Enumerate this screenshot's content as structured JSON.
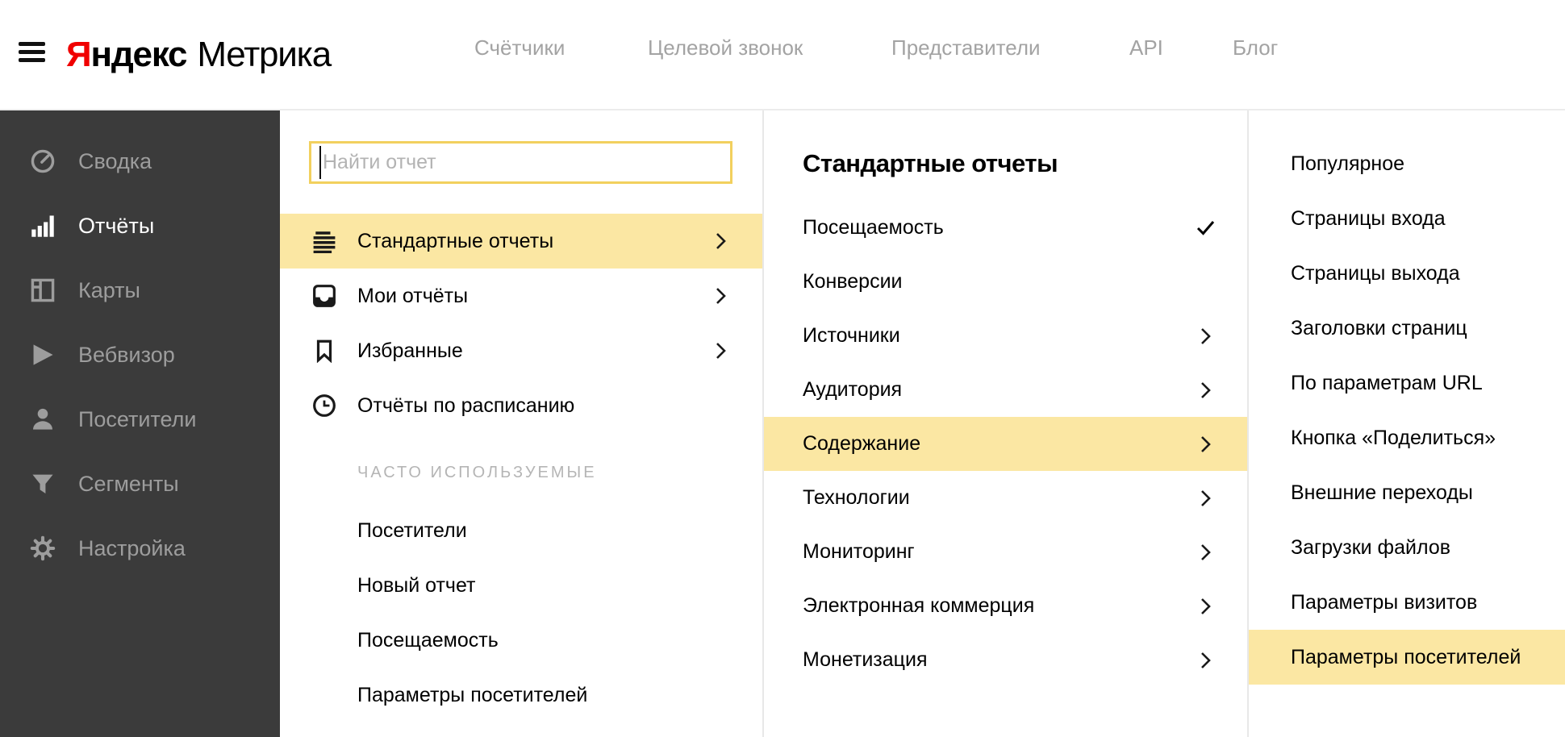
{
  "header": {
    "logo": {
      "brand_first_letter": "Я",
      "brand_rest": "ндекс",
      "product": "Метрика"
    },
    "nav": [
      {
        "label": "Счётчики"
      },
      {
        "label": "Целевой звонок"
      },
      {
        "label": "Представители"
      },
      {
        "label": "API"
      },
      {
        "label": "Блог"
      }
    ]
  },
  "sidebar": {
    "items": [
      {
        "label": "Сводка",
        "icon": "gauge-icon",
        "active": false
      },
      {
        "label": "Отчёты",
        "icon": "bar-chart-icon",
        "active": true
      },
      {
        "label": "Карты",
        "icon": "layout-icon",
        "active": false
      },
      {
        "label": "Вебвизор",
        "icon": "play-icon",
        "active": false
      },
      {
        "label": "Посетители",
        "icon": "person-icon",
        "active": false
      },
      {
        "label": "Сегменты",
        "icon": "funnel-icon",
        "active": false
      },
      {
        "label": "Настройка",
        "icon": "gear-icon",
        "active": false
      }
    ]
  },
  "reports_menu": {
    "search": {
      "placeholder": "Найти отчет"
    },
    "sections": [
      {
        "label": "Стандартные отчеты",
        "icon": "list-icon",
        "highlighted": true,
        "chevron": true
      },
      {
        "label": "Мои отчёты",
        "icon": "inbox-icon",
        "highlighted": false,
        "chevron": true
      },
      {
        "label": "Избранные",
        "icon": "bookmark-icon",
        "highlighted": false,
        "chevron": true
      },
      {
        "label": "Отчёты по расписанию",
        "icon": "clock-icon",
        "highlighted": false,
        "chevron": false
      }
    ],
    "frequent": {
      "title": "ЧАСТО ИСПОЛЬЗУЕМЫЕ",
      "items": [
        {
          "label": "Посетители"
        },
        {
          "label": "Новый отчет"
        },
        {
          "label": "Посещаемость"
        },
        {
          "label": "Параметры посетителей"
        }
      ]
    }
  },
  "standard_reports": {
    "title": "Стандартные отчеты",
    "items": [
      {
        "label": "Посещаемость",
        "checked": true,
        "chevron": false,
        "highlighted": false
      },
      {
        "label": "Конверсии",
        "checked": false,
        "chevron": false,
        "highlighted": false
      },
      {
        "label": "Источники",
        "checked": false,
        "chevron": true,
        "highlighted": false
      },
      {
        "label": "Аудитория",
        "checked": false,
        "chevron": true,
        "highlighted": false
      },
      {
        "label": "Содержание",
        "checked": false,
        "chevron": true,
        "highlighted": true
      },
      {
        "label": "Технологии",
        "checked": false,
        "chevron": true,
        "highlighted": false
      },
      {
        "label": "Мониторинг",
        "checked": false,
        "chevron": true,
        "highlighted": false
      },
      {
        "label": "Электронная коммерция",
        "checked": false,
        "chevron": true,
        "highlighted": false
      },
      {
        "label": "Монетизация",
        "checked": false,
        "chevron": true,
        "highlighted": false
      }
    ]
  },
  "content_submenu": {
    "items": [
      {
        "label": "Популярное",
        "highlighted": false
      },
      {
        "label": "Страницы входа",
        "highlighted": false
      },
      {
        "label": "Страницы выхода",
        "highlighted": false
      },
      {
        "label": "Заголовки страниц",
        "highlighted": false
      },
      {
        "label": "По параметрам URL",
        "highlighted": false
      },
      {
        "label": "Кнопка «Поделиться»",
        "highlighted": false
      },
      {
        "label": "Внешние переходы",
        "highlighted": false
      },
      {
        "label": "Загрузки файлов",
        "highlighted": false
      },
      {
        "label": "Параметры визитов",
        "highlighted": false
      },
      {
        "label": "Параметры посетителей",
        "highlighted": true
      }
    ]
  },
  "colors": {
    "highlight_yellow": "#fbe7a3",
    "search_border_yellow": "#f2d05e",
    "sidebar_background": "#3b3b3b",
    "sidebar_inactive_text": "#9d9d9d",
    "sidebar_active_text": "#ffffff",
    "brand_red": "#f00000",
    "nav_gray": "#a3a3a3"
  }
}
